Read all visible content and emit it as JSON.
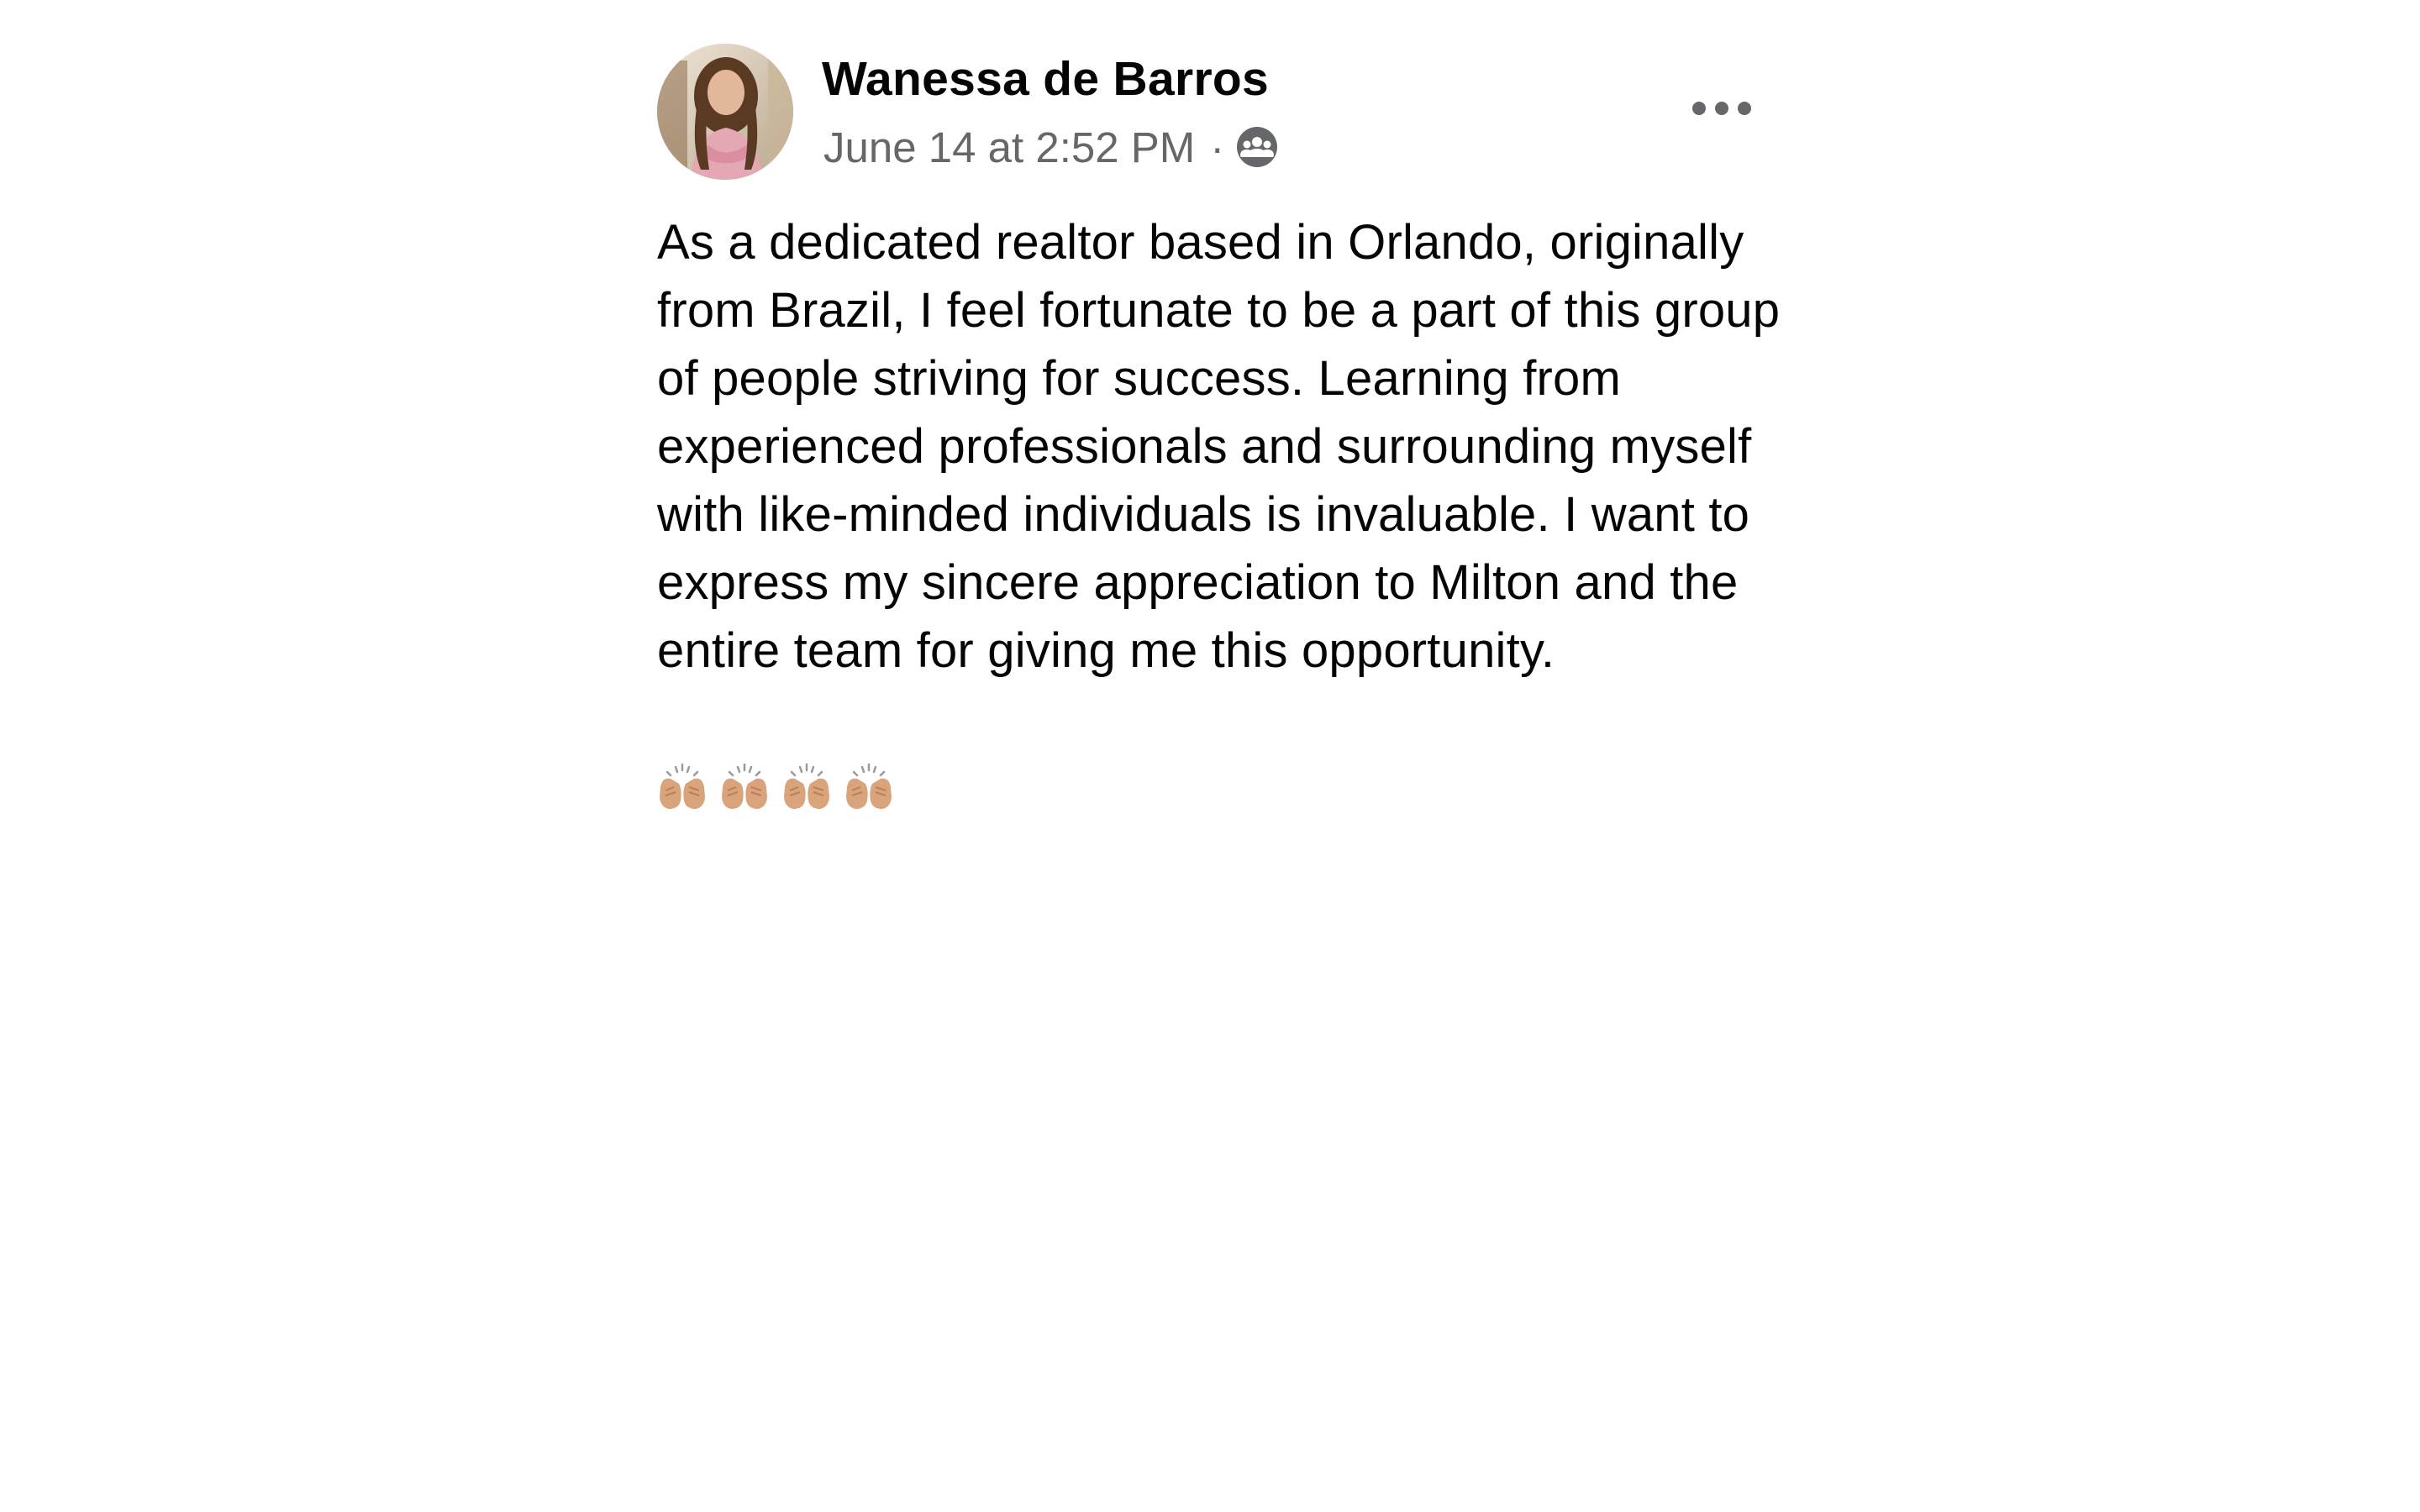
{
  "post": {
    "author": "Wanessa de Barros",
    "timestamp": "June 14 at 2:52 PM",
    "separator": "·",
    "audience_icon": "group-members-icon",
    "more_icon": "more-options-icon",
    "body_text": "As a dedicated realtor based in Orlando, originally from Brazil, I feel fortunate to be a part of this group of people striving for success. Learning from experienced professionals and surrounding myself with like-minded individuals is invaluable. I want to express my sincere appreciation to Milton and the entire team for giving me this opportunity.",
    "emojis": [
      "🙌🏼",
      "🙌🏼",
      "🙌🏼",
      "🙌🏼"
    ]
  },
  "colors": {
    "text_primary": "#050505",
    "text_secondary": "#65676b",
    "background": "#ffffff"
  }
}
